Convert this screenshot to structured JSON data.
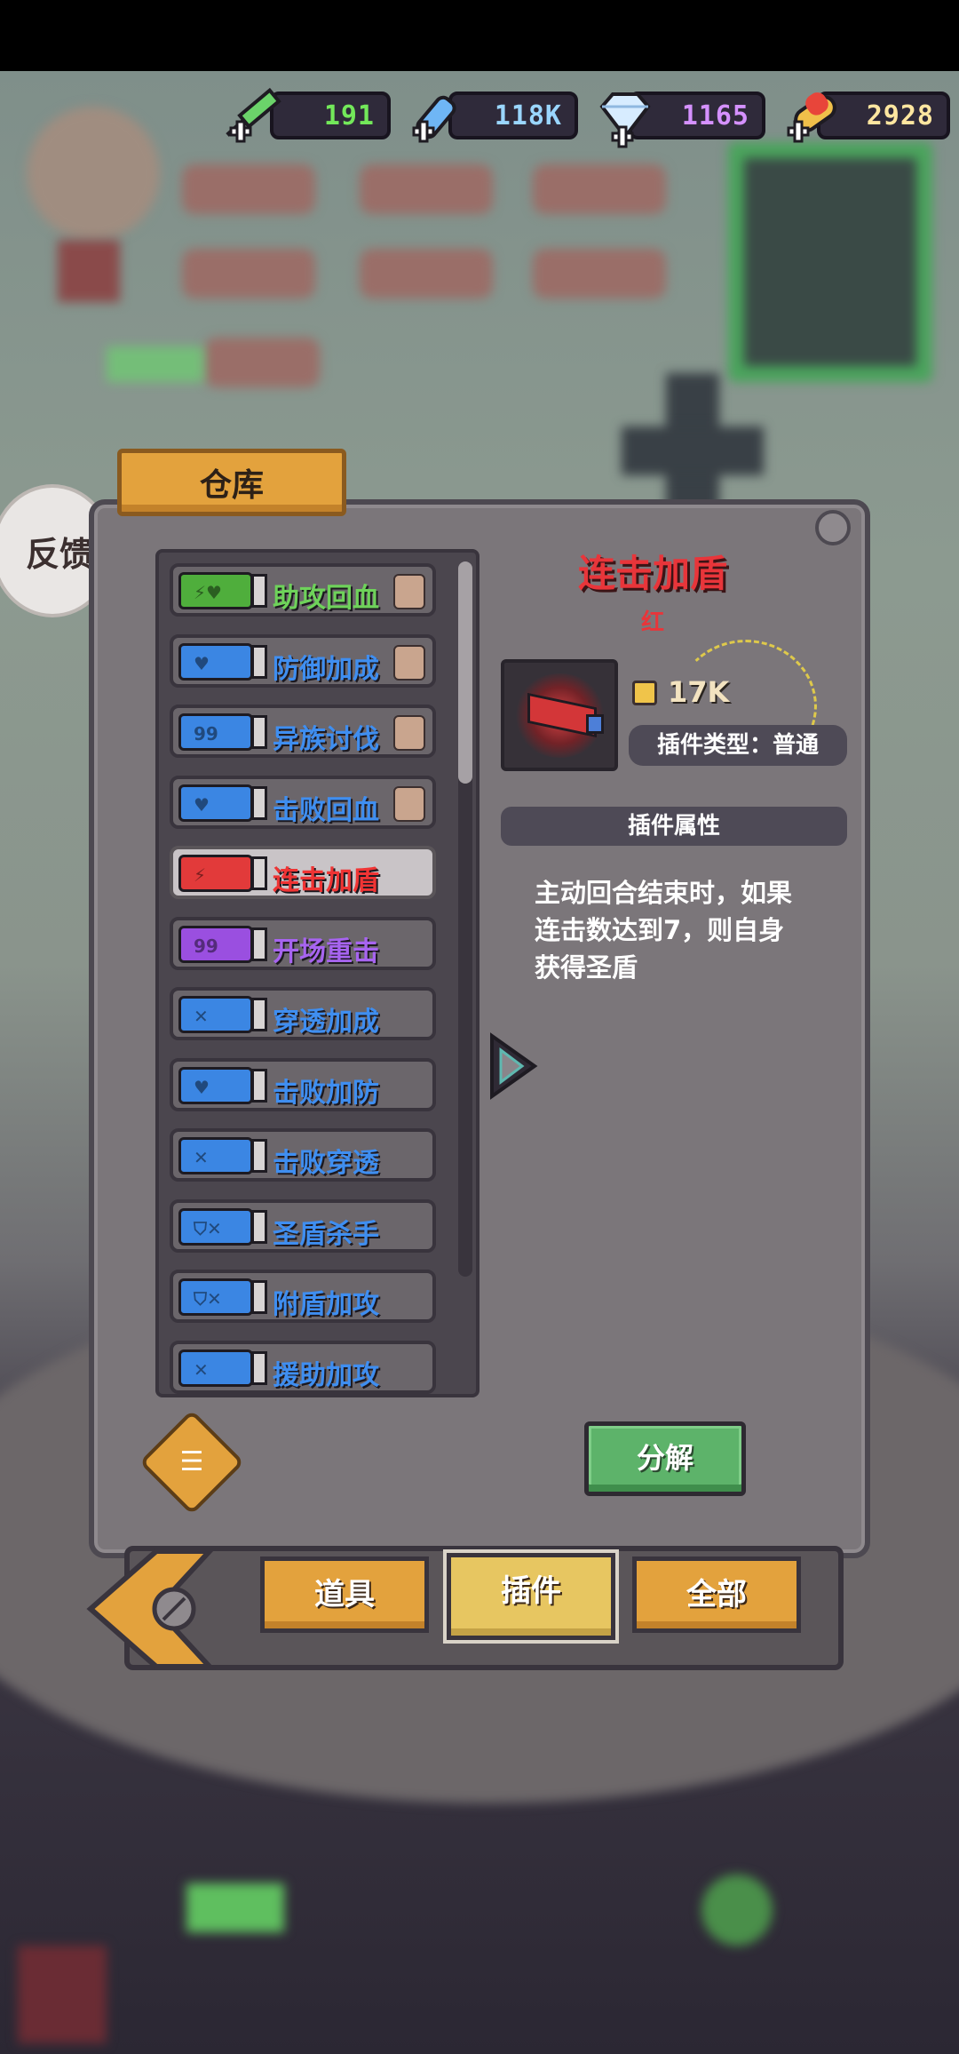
{
  "resources": [
    {
      "name": "syringe",
      "value": "191",
      "color": "#73e85a"
    },
    {
      "name": "vial",
      "value": "118K",
      "color": "#9ad6ff"
    },
    {
      "name": "diamond",
      "value": "1165",
      "color": "#d591ff"
    },
    {
      "name": "pill",
      "value": "2928",
      "color": "#ffe6a0"
    }
  ],
  "feedback": {
    "label": "反馈"
  },
  "panel": {
    "title": "仓库"
  },
  "items": [
    {
      "name": "助攻回血",
      "color": "#4fae3c",
      "text_color": "#6ed25a",
      "symbol": "⚡♥"
    },
    {
      "name": "防御加成",
      "color": "#3b86e3",
      "text_color": "#3f8ef0",
      "symbol": "♥"
    },
    {
      "name": "异族讨伐",
      "color": "#3b86e3",
      "text_color": "#3f8ef0",
      "symbol": "99"
    },
    {
      "name": "击败回血",
      "color": "#3b86e3",
      "text_color": "#3f8ef0",
      "symbol": "♥"
    },
    {
      "name": "连击加盾",
      "color": "#e23a3a",
      "text_color": "#ef3434",
      "symbol": "⚡"
    },
    {
      "name": "开场重击",
      "color": "#9a4fe0",
      "text_color": "#a764f0",
      "symbol": "99"
    },
    {
      "name": "穿透加成",
      "color": "#3b86e3",
      "text_color": "#3f8ef0",
      "symbol": "✕"
    },
    {
      "name": "击败加防",
      "color": "#3b86e3",
      "text_color": "#3f8ef0",
      "symbol": "♥"
    },
    {
      "name": "击败穿透",
      "color": "#3b86e3",
      "text_color": "#3f8ef0",
      "symbol": "✕"
    },
    {
      "name": "圣盾杀手",
      "color": "#3b86e3",
      "text_color": "#3f8ef0",
      "symbol": "⛉✕"
    },
    {
      "name": "附盾加攻",
      "color": "#3b86e3",
      "text_color": "#3f8ef0",
      "symbol": "⛉✕"
    },
    {
      "name": "援助加攻",
      "color": "#3b86e3",
      "text_color": "#3f8ef0",
      "symbol": "✕"
    }
  ],
  "detail": {
    "name": "连击加盾",
    "rarity": "红",
    "power": "17K",
    "type_label": "插件类型：普通",
    "attr_header": "插件属性",
    "description": "主动回合结束时，如果连击数达到7，则自身获得圣盾"
  },
  "actions": {
    "decompose": "分解"
  },
  "tabs": [
    {
      "label": "道具"
    },
    {
      "label": "插件"
    },
    {
      "label": "全部"
    }
  ]
}
